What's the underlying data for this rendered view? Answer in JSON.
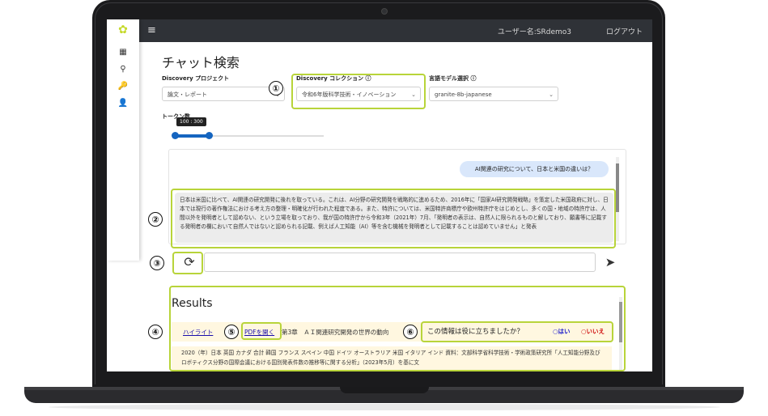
{
  "header": {
    "menu_icon": "hamburger-icon",
    "user_label": "ユーザー名:SRdemo3",
    "logout_label": "ログアウト"
  },
  "sidebar": {
    "items": [
      {
        "icon": "grid-icon",
        "glyph": "▦"
      },
      {
        "icon": "search-icon",
        "glyph": "⚲"
      },
      {
        "icon": "key-icon",
        "glyph": "🔑"
      },
      {
        "icon": "user-settings-icon",
        "glyph": "👤"
      }
    ]
  },
  "page": {
    "title": "チャット検索"
  },
  "form": {
    "project_label": "Discovery プロジェクト",
    "project_value": "論文・レポート",
    "collection_label": "Discovery コレクション",
    "collection_value": "令和6年版科学技術・イノベーション",
    "model_label": "言語モデル選択",
    "model_value": "granite-8b-japanese",
    "token_label": "トークン数",
    "token_tooltip": "100 : 300",
    "token_min": 100,
    "token_max": 300
  },
  "chat": {
    "user_message": "AI関連の研究について、日本と米国の違いは？",
    "ai_message": "日本は米国に比べて、AI関連の研究開発に後れを取っている。これは、AI分野の研究開発を戦略的に進めるため、2016年に「国家AI研究開発戦略」を策定した米国政府に対し、日本では現行の著作権法における考え方の整理・明確化が行われた程度である。また、特許については、米国特許商標庁や欧州特許庁をはじめとし、多くの国・地域の特許庁は、人間以外を発明者として認めない、という立場を取っており、我が国の特許庁から令和3年（2021年）7月、「発明者の表示は、自然人に限られるものと解しており、願書等に記載する発明者の欄において自然人ではないと認められる記載、例えば人工知能（AI）等を含む機械を発明者として記載することは認めていません」と発表",
    "input_placeholder": ""
  },
  "results": {
    "title": "Results",
    "highlight_link": "ハイライト",
    "pdf_link": "PDFを開く",
    "chapter": "第3章　ＡＩ関連研究開発の世界の動向",
    "feedback_question": "この情報は役に立ちましたか？",
    "feedback_yes": "○はい",
    "feedback_no": "○いいえ",
    "snippet": "2020（年）日本 英国 カナダ 合計 韓国 フランス スペイン 中国 ドイツ オーストラリア 米国 イタリア インド 資料：文部科学省科学技術・学術政策研究所「人工知能分野及びロボティクス分野の国際会議における国別発表件数の推移等に関する分析」（2023年5月）を基に文"
  },
  "annotations": [
    "①",
    "②",
    "③",
    "④",
    "⑤",
    "⑥"
  ],
  "colors": {
    "accent": "#b8d43a",
    "topbar": "#2f3237",
    "slider": "#1565c0",
    "result_bg": "#fff7e0"
  }
}
